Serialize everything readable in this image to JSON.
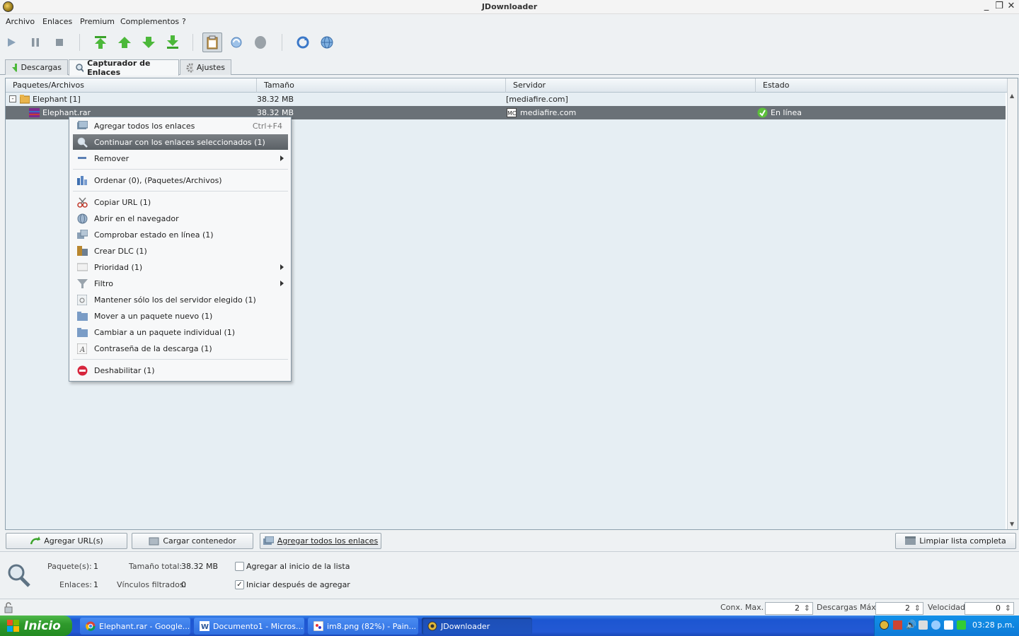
{
  "window": {
    "title": "JDownloader"
  },
  "menubar": {
    "items": [
      "Archivo",
      "Enlaces",
      "Premium",
      "Complementos",
      "?"
    ]
  },
  "tabs": [
    {
      "label": "Descargas",
      "icon": "download-arrow-icon"
    },
    {
      "label": "Capturador de Enlaces",
      "icon": "linkgrabber-magnifier-icon"
    },
    {
      "label": "Ajustes",
      "icon": "gear-icon"
    }
  ],
  "table": {
    "columns": [
      "Paquetes/Archivos",
      "Tamaño",
      "Servidor",
      "Estado"
    ],
    "package": {
      "name": "Elephant [1]",
      "size": "38.32 MB",
      "host": "[mediafire.com]",
      "status": ""
    },
    "file": {
      "name": "Elephant.rar",
      "size": "38.32 MB",
      "host": "mediafire.com",
      "host_badge": "MC",
      "status": "En línea"
    }
  },
  "context_menu": {
    "items": [
      {
        "label": "Agregar todos los enlaces",
        "accel": "Ctrl+F4",
        "icon": "add-links-icon"
      },
      {
        "label": "Continuar con los enlaces seleccionados (1)",
        "icon": "magnifier-icon",
        "highlighted": true
      },
      {
        "label": "Remover",
        "icon": "minus-icon",
        "submenu": true
      },
      {
        "label": "Ordenar (0), (Paquetes/Archivos)",
        "icon": "sort-icon"
      },
      {
        "label": "Copiar URL (1)",
        "icon": "scissors-icon"
      },
      {
        "label": "Abrir en el navegador",
        "icon": "globe-icon"
      },
      {
        "label": "Comprobar estado en línea (1)",
        "icon": "check-online-icon"
      },
      {
        "label": "Crear DLC (1)",
        "icon": "dlc-icon"
      },
      {
        "label": "Prioridad (1)",
        "icon": "priority-icon",
        "submenu": true
      },
      {
        "label": "Filtro",
        "icon": "filter-icon",
        "submenu": true
      },
      {
        "label": "Mantener sólo los del servidor elegido (1)",
        "icon": "server-icon"
      },
      {
        "label": "Mover a un paquete nuevo (1)",
        "icon": "folder-icon"
      },
      {
        "label": "Cambiar a un paquete individual (1)",
        "icon": "folder-icon"
      },
      {
        "label": "Contraseña de la descarga (1)",
        "icon": "password-icon"
      },
      {
        "label": "Deshabilitar (1)",
        "icon": "disable-icon"
      }
    ]
  },
  "bottom_buttons": {
    "add_urls": "Agregar URL(s)",
    "load_container": "Cargar contenedor",
    "add_all_links": "Agregar todos los enlaces",
    "clear_list": "Limpiar lista completa"
  },
  "info": {
    "packages_label": "Paquete(s):",
    "packages_value": "1",
    "links_label": "Enlaces:",
    "links_value": "1",
    "total_size_label": "Tamaño total:",
    "total_size_value": "38.32 MB",
    "filtered_label": "Vínculos filtrados:",
    "filtered_value": "0",
    "add_top_label": "Agregar al inicio de la lista",
    "add_top_checked": false,
    "start_after_label": "Iniciar después de agregar",
    "start_after_checked": true
  },
  "statusbar": {
    "max_conn_label": "Conx. Max.",
    "max_conn_value": "2",
    "max_dl_label": "Descargas Máx.",
    "max_dl_value": "2",
    "speed_label": "Velocidad",
    "speed_value": "0"
  },
  "taskbar": {
    "start_label": "Inicio",
    "tasks": [
      {
        "label": "Elephant.rar - Google...",
        "icon": "chrome-icon"
      },
      {
        "label": "Documento1 - Micros...",
        "icon": "word-icon"
      },
      {
        "label": "im8.png (82%) - Pain...",
        "icon": "paint-icon"
      },
      {
        "label": "JDownloader",
        "icon": "jdownloader-icon",
        "active": true
      }
    ],
    "clock": "03:28 p.m."
  },
  "colors": {
    "selection_row": "#6a7177",
    "table_bg": "#e6eef3",
    "taskbar": "#245edb",
    "start": "#2f9a2c"
  }
}
